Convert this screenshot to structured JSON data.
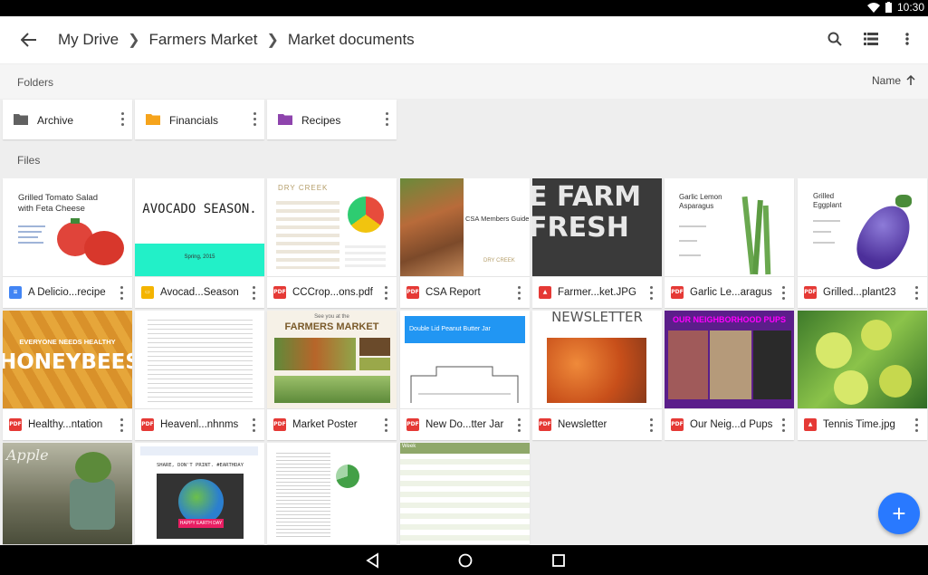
{
  "status_bar": {
    "time": "10:30"
  },
  "breadcrumb": {
    "items": [
      "My Drive",
      "Farmers Market",
      "Market documents"
    ]
  },
  "toolbar": {
    "search_icon": "search-icon",
    "view_icon": "list-view-icon",
    "menu_icon": "more-vert-icon"
  },
  "folders_section": {
    "label": "Folders",
    "sort_label": "Name"
  },
  "folders": [
    {
      "name": "Archive",
      "color": "#616161"
    },
    {
      "name": "Financials",
      "color": "#f6a41c"
    },
    {
      "name": "Recipes",
      "color": "#8e44ad"
    }
  ],
  "files_section": {
    "label": "Files"
  },
  "files": [
    {
      "name": "A Delicio...recipe",
      "type": "doc",
      "thumb_title": "Grilled Tomato Salad with Feta Cheese"
    },
    {
      "name": "Avocad...Season",
      "type": "slides",
      "thumb_title": "AVOCADO SEASON.",
      "thumb_sub": "Spring, 2015"
    },
    {
      "name": "CCCrop...ons.pdf",
      "type": "pdf",
      "thumb_title": "DRY CREEK"
    },
    {
      "name": "CSA Report",
      "type": "pdf",
      "thumb_title": "CSA Members Guide",
      "thumb_sub": "DRY CREEK"
    },
    {
      "name": "Farmer...ket.JPG",
      "type": "image",
      "thumb_title": "E FARM FRESH"
    },
    {
      "name": "Garlic Le...aragus",
      "type": "pdf",
      "thumb_title": "Garlic Lemon Asparagus"
    },
    {
      "name": "Grilled...plant23",
      "type": "pdf",
      "thumb_title": "Grilled Eggplant"
    },
    {
      "name": "Healthy...ntation",
      "type": "pdf",
      "thumb_title": "EVERYONE NEEDS HEALTHY",
      "thumb_sub": "HONEYBEES"
    },
    {
      "name": "Heavenl...nhnms",
      "type": "pdf"
    },
    {
      "name": "Market Poster",
      "type": "pdf",
      "thumb_title": "FARMERS MARKET",
      "thumb_sub": "See you at the"
    },
    {
      "name": "New Do...tter Jar",
      "type": "pdf",
      "thumb_title": "Double Lid Peanut Butter Jar"
    },
    {
      "name": "Newsletter",
      "type": "pdf",
      "thumb_title": "NEWSLETTER"
    },
    {
      "name": "Our Neig...d Pups",
      "type": "pdf",
      "thumb_title": "OUR NEIGHBORHOOD PUPS"
    },
    {
      "name": "Tennis Time.jpg",
      "type": "image"
    },
    {
      "name": "",
      "type": "image",
      "thumb_title": "Apple"
    },
    {
      "name": "",
      "type": "doc",
      "thumb_title": "SHARE, DON'T PRINT. #EARTHDAY",
      "thumb_sub": "HAPPY EARTH DAY"
    },
    {
      "name": "",
      "type": "sheet"
    },
    {
      "name": "",
      "type": "sheet",
      "thumb_title": "Week"
    }
  ],
  "colors": {
    "pdf": "#e53935",
    "doc": "#4285f4",
    "slides": "#f4b400",
    "image": "#e53935",
    "fab": "#2979ff"
  },
  "fab": {
    "icon": "add-icon",
    "label": "+"
  },
  "nav_bar": {
    "back_icon": "nav-back-icon",
    "home_icon": "nav-home-icon",
    "recents_icon": "nav-recents-icon"
  }
}
